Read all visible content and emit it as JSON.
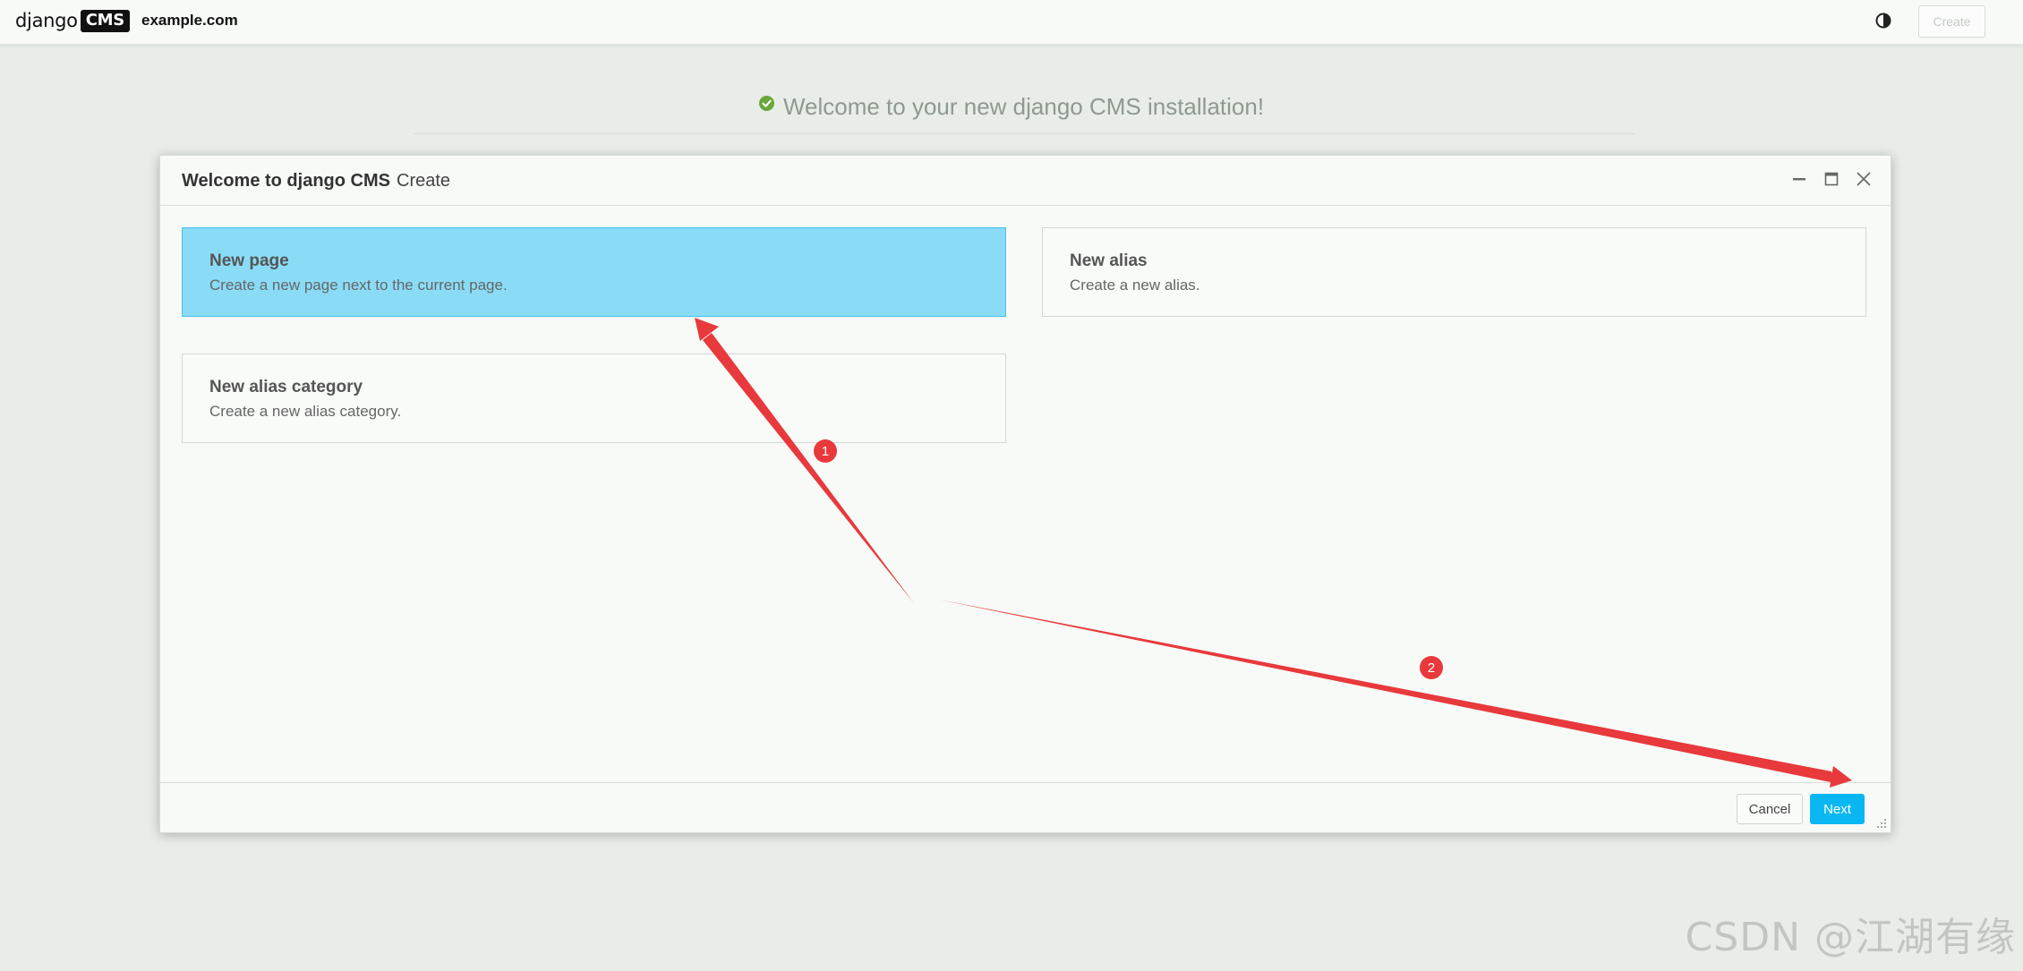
{
  "toolbar": {
    "logo_text": "django",
    "logo_badge": "CMS",
    "site_name": "example.com",
    "contrast_icon": "half-circle-contrast-icon",
    "create_label": "Create"
  },
  "background": {
    "welcome_text": "Welcome to your new django CMS installation!",
    "check_icon": "check-circle-icon",
    "check_color": "#6aa63a"
  },
  "modal": {
    "title": "Welcome to django CMS",
    "breadcrumb": "Create",
    "controls": [
      "minimize-icon",
      "maximize-icon",
      "close-icon"
    ],
    "options": [
      {
        "title": "New page",
        "description": "Create a new page next to the current page.",
        "selected": true
      },
      {
        "title": "New alias",
        "description": "Create a new alias.",
        "selected": false
      },
      {
        "title": "New alias category",
        "description": "Create a new alias category.",
        "selected": false
      }
    ],
    "footer": {
      "cancel_label": "Cancel",
      "next_label": "Next"
    }
  },
  "annotations": {
    "color": "#e8393c",
    "badges": [
      "1",
      "2"
    ]
  },
  "watermark": "CSDN @江湖有缘",
  "colors": {
    "accent": "#0bb7f2",
    "selected_bg": "#8adcf6"
  }
}
